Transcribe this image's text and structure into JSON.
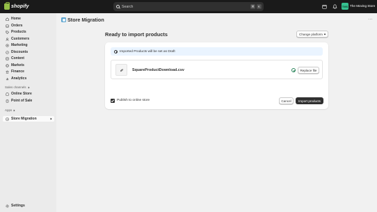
{
  "topbar": {
    "brand": "shopify",
    "search_placeholder": "Search",
    "shortcut_key1": "⌘",
    "shortcut_key2": "K",
    "store_initials": "TMS",
    "store_name": "The Moving Store"
  },
  "sidebar": {
    "items": [
      {
        "label": "Home",
        "icon": "home-icon"
      },
      {
        "label": "Orders",
        "icon": "orders-icon"
      },
      {
        "label": "Products",
        "icon": "tag-icon"
      },
      {
        "label": "Customers",
        "icon": "person-icon"
      },
      {
        "label": "Marketing",
        "icon": "target-icon"
      },
      {
        "label": "Discounts",
        "icon": "discount-icon"
      },
      {
        "label": "Content",
        "icon": "content-icon"
      },
      {
        "label": "Markets",
        "icon": "globe-icon"
      },
      {
        "label": "Finance",
        "icon": "bank-icon"
      },
      {
        "label": "Analytics",
        "icon": "chart-icon"
      }
    ],
    "sales_channels_label": "Sales channels",
    "channels": [
      {
        "label": "Online Store",
        "icon": "store-icon"
      },
      {
        "label": "Point of Sale",
        "icon": "pos-icon"
      }
    ],
    "apps_label": "Apps",
    "apps": [
      {
        "label": "Store Migration",
        "icon": "migration-icon"
      }
    ],
    "settings_label": "Settings"
  },
  "page": {
    "title": "Store Migration",
    "more": "···",
    "heading": "Ready to import products",
    "change_platform": "Change platform",
    "banner_text": "Imported Products will be set as Draft",
    "file_name": "SquareProductDownload.csv",
    "replace_file": "Replace file",
    "publish_label": "Publish to online store",
    "cancel": "Cancel",
    "import": "Import products"
  },
  "colors": {
    "topbar": "#1a1a1a",
    "sidebar": "#ebebeb",
    "primary_button": "#303030",
    "banner": "#eaf4ff",
    "success": "#29845a",
    "brand_green": "#95bf47"
  }
}
